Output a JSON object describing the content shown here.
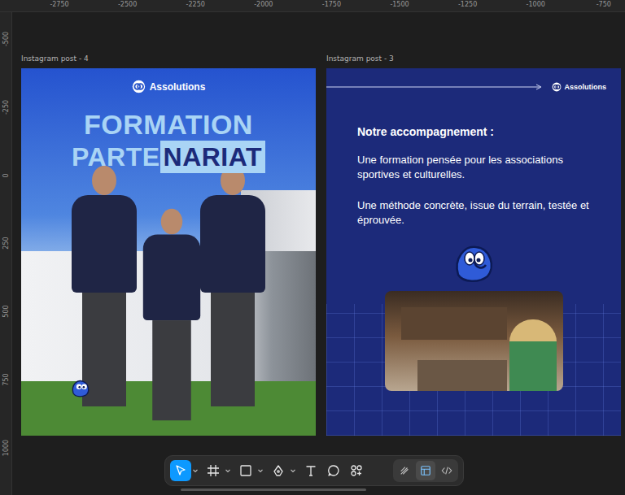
{
  "rulers": {
    "x": [
      "-2750",
      "-2500",
      "-2250",
      "-2000",
      "-1750",
      "-1500",
      "-1250",
      "-1000",
      "-750"
    ],
    "y": [
      "-500",
      "-250",
      "0",
      "250",
      "500",
      "750",
      "1000"
    ]
  },
  "post_4": {
    "label": "Instagram post - 4",
    "logo": "Assolutions",
    "title": "FORMATION",
    "subtitle_plain": "PARTE",
    "subtitle_highlight": "NARIAT"
  },
  "post_3": {
    "label": "Instagram post - 3",
    "logo": "Assolutions",
    "heading": "Notre accompagnement :",
    "paragraphs": [
      "Une formation pensée pour les associations sportives et culturelles.",
      "Une méthode concrète, issue du terrain, testée et éprouvée."
    ]
  },
  "toolbar": {
    "tools": [
      {
        "kind": "move",
        "selected": true,
        "menu": true
      },
      {
        "kind": "frame",
        "selected": false,
        "menu": true
      },
      {
        "kind": "rectangle",
        "selected": false,
        "menu": true
      },
      {
        "kind": "pen",
        "selected": false,
        "menu": true
      },
      {
        "kind": "text",
        "selected": false,
        "menu": false
      },
      {
        "kind": "comment",
        "selected": false,
        "menu": false
      },
      {
        "kind": "actions",
        "selected": false,
        "menu": false
      }
    ],
    "modes": [
      {
        "kind": "draw",
        "selected": false
      },
      {
        "kind": "design",
        "selected": true
      },
      {
        "kind": "dev",
        "selected": false
      }
    ]
  }
}
